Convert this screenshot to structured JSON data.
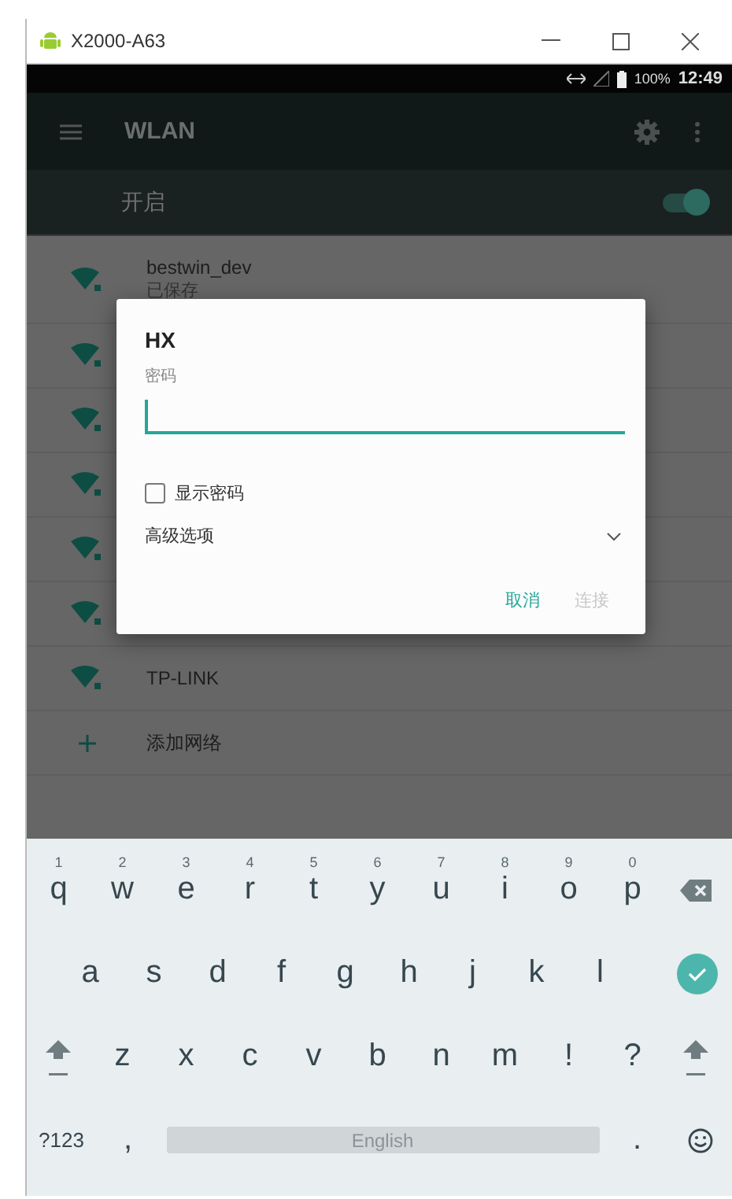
{
  "window": {
    "title": "X2000-A63"
  },
  "status_bar": {
    "battery": "100%",
    "time": "12:49"
  },
  "app_bar": {
    "title": "WLAN"
  },
  "wlan_switch": {
    "label": "开启",
    "on": true
  },
  "networks": [
    {
      "kind": "network",
      "ssid": "bestwin_dev",
      "status": "已保存"
    },
    {
      "kind": "network"
    },
    {
      "kind": "network"
    },
    {
      "kind": "network"
    },
    {
      "kind": "network"
    },
    {
      "kind": "network"
    },
    {
      "kind": "network",
      "ssid": "TP-LINK"
    },
    {
      "kind": "add",
      "label": "添加网络"
    }
  ],
  "dialog": {
    "title": "HX",
    "password_label": "密码",
    "show_password": {
      "label": "显示密码",
      "checked": false
    },
    "advanced": {
      "label": "高级选项",
      "expanded": false
    },
    "buttons": [
      {
        "label": "取消",
        "disabled": false
      },
      {
        "label": "连接",
        "disabled": true
      }
    ]
  },
  "keyboard": {
    "rows": [
      {
        "keys": [
          {
            "kind": "char",
            "label": "q",
            "hint": "1"
          },
          {
            "kind": "char",
            "label": "w",
            "hint": "2"
          },
          {
            "kind": "char",
            "label": "e",
            "hint": "3"
          },
          {
            "kind": "char",
            "label": "r",
            "hint": "4"
          },
          {
            "kind": "char",
            "label": "t",
            "hint": "5"
          },
          {
            "kind": "char",
            "label": "y",
            "hint": "6"
          },
          {
            "kind": "char",
            "label": "u",
            "hint": "7"
          },
          {
            "kind": "char",
            "label": "i",
            "hint": "8"
          },
          {
            "kind": "char",
            "label": "o",
            "hint": "9"
          },
          {
            "kind": "char",
            "label": "p",
            "hint": "0"
          },
          {
            "kind": "backspace"
          }
        ]
      },
      {
        "keys": [
          {
            "kind": "char",
            "label": "a"
          },
          {
            "kind": "char",
            "label": "s"
          },
          {
            "kind": "char",
            "label": "d"
          },
          {
            "kind": "char",
            "label": "f"
          },
          {
            "kind": "char",
            "label": "g"
          },
          {
            "kind": "char",
            "label": "h"
          },
          {
            "kind": "char",
            "label": "j"
          },
          {
            "kind": "char",
            "label": "k"
          },
          {
            "kind": "char",
            "label": "l"
          },
          {
            "kind": "enter"
          }
        ]
      },
      {
        "keys": [
          {
            "kind": "shift"
          },
          {
            "kind": "char",
            "label": "z"
          },
          {
            "kind": "char",
            "label": "x"
          },
          {
            "kind": "char",
            "label": "c"
          },
          {
            "kind": "char",
            "label": "v"
          },
          {
            "kind": "char",
            "label": "b"
          },
          {
            "kind": "char",
            "label": "n"
          },
          {
            "kind": "char",
            "label": "m"
          },
          {
            "kind": "char",
            "label": "!"
          },
          {
            "kind": "char",
            "label": "?"
          },
          {
            "kind": "shift"
          }
        ]
      },
      {
        "keys": [
          {
            "kind": "symbols",
            "label": "?123"
          },
          {
            "kind": "char",
            "label": ","
          },
          {
            "kind": "space",
            "label": "English"
          },
          {
            "kind": "char",
            "label": "."
          },
          {
            "kind": "emoji"
          }
        ]
      }
    ]
  }
}
